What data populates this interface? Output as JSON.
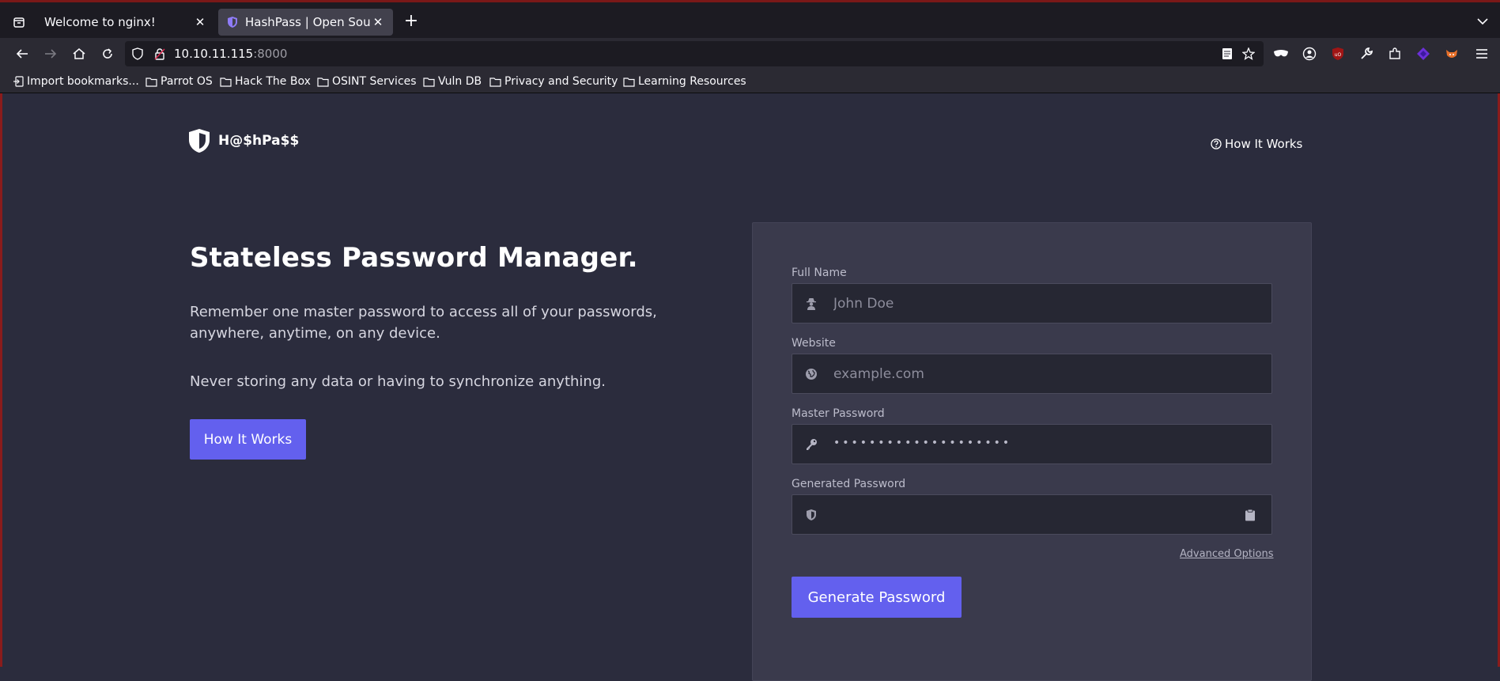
{
  "browser": {
    "tabs": [
      {
        "title": "Welcome to nginx!",
        "active": false
      },
      {
        "title": "HashPass | Open Source",
        "active": true
      }
    ],
    "url": {
      "host": "10.10.11.115",
      "port": ":8000"
    },
    "bookmarks": [
      "Import bookmarks...",
      "Parrot OS",
      "Hack The Box",
      "OSINT Services",
      "Vuln DB",
      "Privacy and Security",
      "Learning Resources"
    ]
  },
  "site": {
    "brand": "H@$hPa$$",
    "nav_link": "How It Works"
  },
  "hero": {
    "title": "Stateless Password Manager.",
    "paragraph1": "Remember one master password to access all of your passwords, anywhere, anytime, on any device.",
    "paragraph2": "Never storing any data or having to synchronize anything.",
    "button": "How It Works"
  },
  "form": {
    "full_name": {
      "label": "Full Name",
      "placeholder": "John Doe",
      "icon": "user-secret-icon"
    },
    "website": {
      "label": "Website",
      "placeholder": "example.com",
      "icon": "globe-icon"
    },
    "master_password": {
      "label": "Master Password",
      "masked_value": "••••••••••••••••••••",
      "icon": "key-icon"
    },
    "generated_password": {
      "label": "Generated Password",
      "value": "",
      "icon": "shield-icon",
      "action_icon": "clipboard-icon"
    },
    "advanced_link": "Advanced Options",
    "submit": "Generate Password"
  },
  "colors": {
    "accent": "#6360ee",
    "page_bg": "#2b2c3d",
    "card_bg": "#3a3a4c",
    "input_bg": "#262733"
  }
}
